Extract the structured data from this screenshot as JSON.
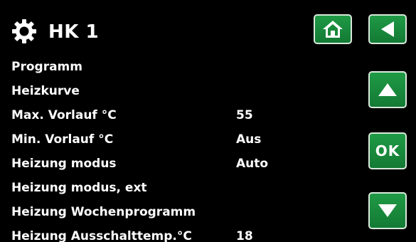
{
  "header": {
    "title": "HK 1",
    "settings_icon": "gear-icon"
  },
  "nav": {
    "home_icon": "home-icon",
    "back_icon": "back-arrow-icon",
    "up_icon": "arrow-up-icon",
    "ok_label": "OK",
    "down_icon": "arrow-down-icon"
  },
  "menu": {
    "items": [
      {
        "label": "Programm",
        "value": ""
      },
      {
        "label": "Heizkurve",
        "value": ""
      },
      {
        "label": "Max. Vorlauf °C",
        "value": "55"
      },
      {
        "label": "Min. Vorlauf °C",
        "value": "Aus"
      },
      {
        "label": "Heizung modus",
        "value": "Auto"
      },
      {
        "label": "Heizung modus, ext",
        "value": ""
      },
      {
        "label": "Heizung Wochenprogramm",
        "value": ""
      },
      {
        "label": "Heizung Ausschalttemp.°C",
        "value": "18"
      }
    ]
  },
  "colors": {
    "background": "#000000",
    "button_green": "#1a8a3c",
    "button_border": "#d8e8dc",
    "text": "#ffffff"
  }
}
